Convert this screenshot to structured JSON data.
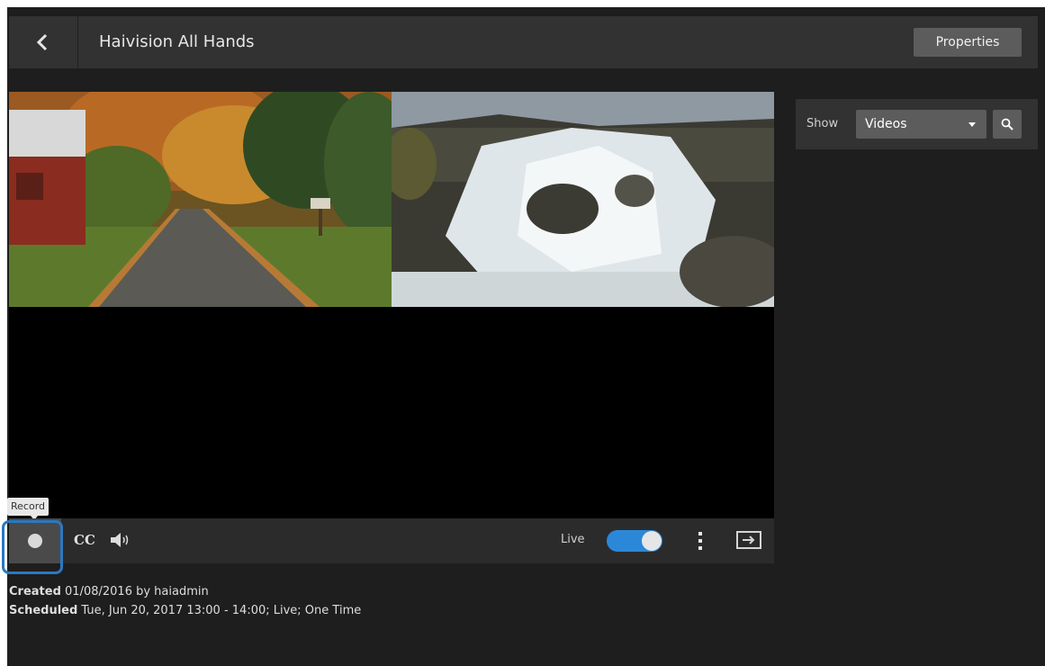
{
  "header": {
    "back_icon": "chevron-left-icon",
    "title": "Haivision All Hands",
    "properties_label": "Properties"
  },
  "player": {
    "tooltip": "Record",
    "record_icon": "record-icon",
    "cc_label": "CC",
    "volume_icon": "volume-icon",
    "live_label": "Live",
    "live_enabled": true,
    "more_icon": "vertical-ellipsis-icon",
    "fullscreen_icon": "fullscreen-icon",
    "accent_color": "#2b88d8"
  },
  "meta": {
    "created_label": "Created",
    "created_value": "01/08/2016 by haiadmin",
    "scheduled_label": "Scheduled",
    "scheduled_value": "Tue, Jun 20, 2017 13:00 - 14:00; Live; One Time"
  },
  "sidebar": {
    "show_label": "Show",
    "show_selected": "Videos",
    "search_icon": "search-icon"
  }
}
